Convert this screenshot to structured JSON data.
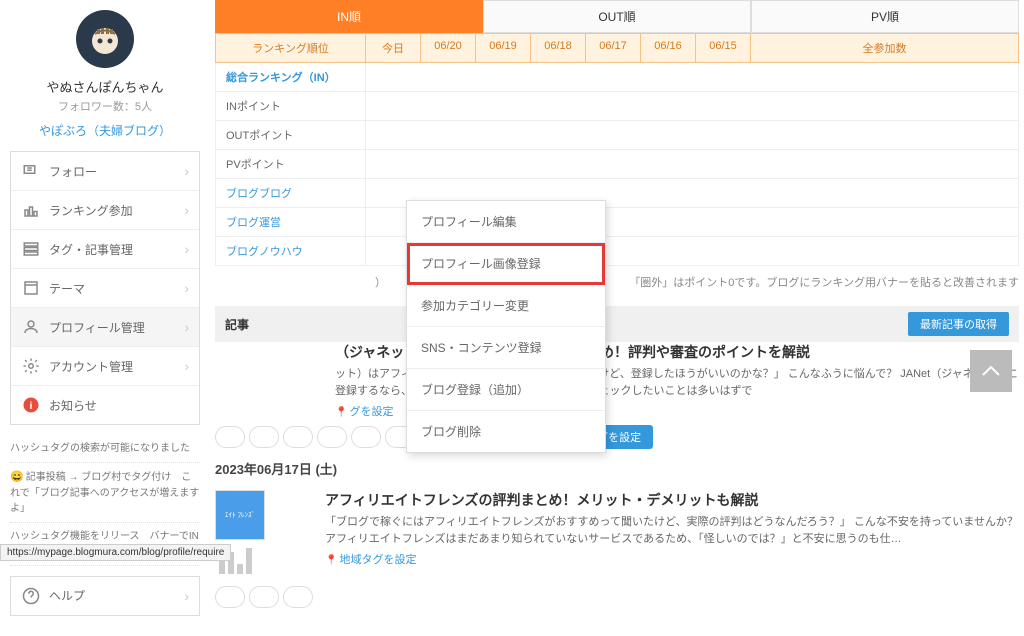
{
  "profile": {
    "username": "やぬさんぽんちゃん",
    "followers_label": "フォロワー数：5人",
    "blog_link": "やぽぶろ（夫婦ブログ）"
  },
  "sidebar_menu": [
    {
      "label": "フォロー",
      "icon": "follow"
    },
    {
      "label": "ランキング参加",
      "icon": "rank"
    },
    {
      "label": "タグ・記事管理",
      "icon": "tag"
    },
    {
      "label": "テーマ",
      "icon": "theme"
    },
    {
      "label": "プロフィール管理",
      "icon": "profile",
      "active": true
    },
    {
      "label": "アカウント管理",
      "icon": "gear"
    },
    {
      "label": "お知らせ",
      "icon": "info"
    }
  ],
  "notices": [
    {
      "text": "ハッシュタグの検索が可能になりました"
    },
    {
      "emoji": "😄",
      "text": "記事投稿 → ブログ村でタグ付け　これで「ブログ記事へのアクセスが増えますよ」"
    },
    {
      "text": "ハッシュタグ機能をリリース　バナーでINポイントも発生します"
    }
  ],
  "help_label": "ヘルプ",
  "submenu": {
    "items": [
      "プロフィール編集",
      "プロフィール画像登録",
      "参加カテゴリー変更",
      "SNS・コンテンツ登録",
      "ブログ登録（追加）",
      "ブログ削除"
    ],
    "highlighted_index": 1
  },
  "tabs": [
    "IN順",
    "OUT順",
    "PV順"
  ],
  "rank_header": {
    "rank_label": "ランキング順位",
    "today": "今日",
    "dates": [
      "06/20",
      "06/19",
      "06/18",
      "06/17",
      "06/16",
      "06/15"
    ],
    "total": "全参加数"
  },
  "rank_rows": [
    "総合ランキング（IN）",
    "INポイント",
    "OUTポイント",
    "PVポイント",
    "ブログブログ",
    "ブログ運営",
    "ブログノウハウ"
  ],
  "rank_note_left": "）",
  "rank_note_right": "「圏外」はポイント0です。ブログにランキング用バナーを貼ると改善されます",
  "article_section": "記事",
  "latest_btn": "最新記事の取得",
  "geo_set": "グを設定",
  "hashtag_set": "# ハッシュタグを設定",
  "date1": "2023年06月17日 (土)",
  "article1": {
    "title": "（ジャネット）はアフィリエイトにおすすめ！評判や審査のポイントを解説",
    "desc": "ット）はアフィリエイトにおすすめのASPって聞いたけど、登録したほうがいいのかな？」 こんなふうに悩んで？ JANet（ジャネット）に登録するなら、評判や審査のポイントなど、事前にチェックしたいことは多いはずで"
  },
  "article2": {
    "title": "アフィリエイトフレンズの評判まとめ！メリット・デメリットも解説",
    "desc": "「ブログで稼ぐにはアフィリエイトフレンズがおすすめって聞いたけど、実際の評判はどうなんだろう？」 こんな不安を持っていませんか？ アフィリエイトフレンズはまだあまり知られていないサービスであるため、「怪しいのでは？」と不安に思うのも仕…",
    "geo": "地域タグを設定",
    "thumb_text": "ｴｲﾄ ﾌﾚﾝｽﾞ"
  },
  "status_url": "https://mypage.blogmura.com/blog/profile/require"
}
